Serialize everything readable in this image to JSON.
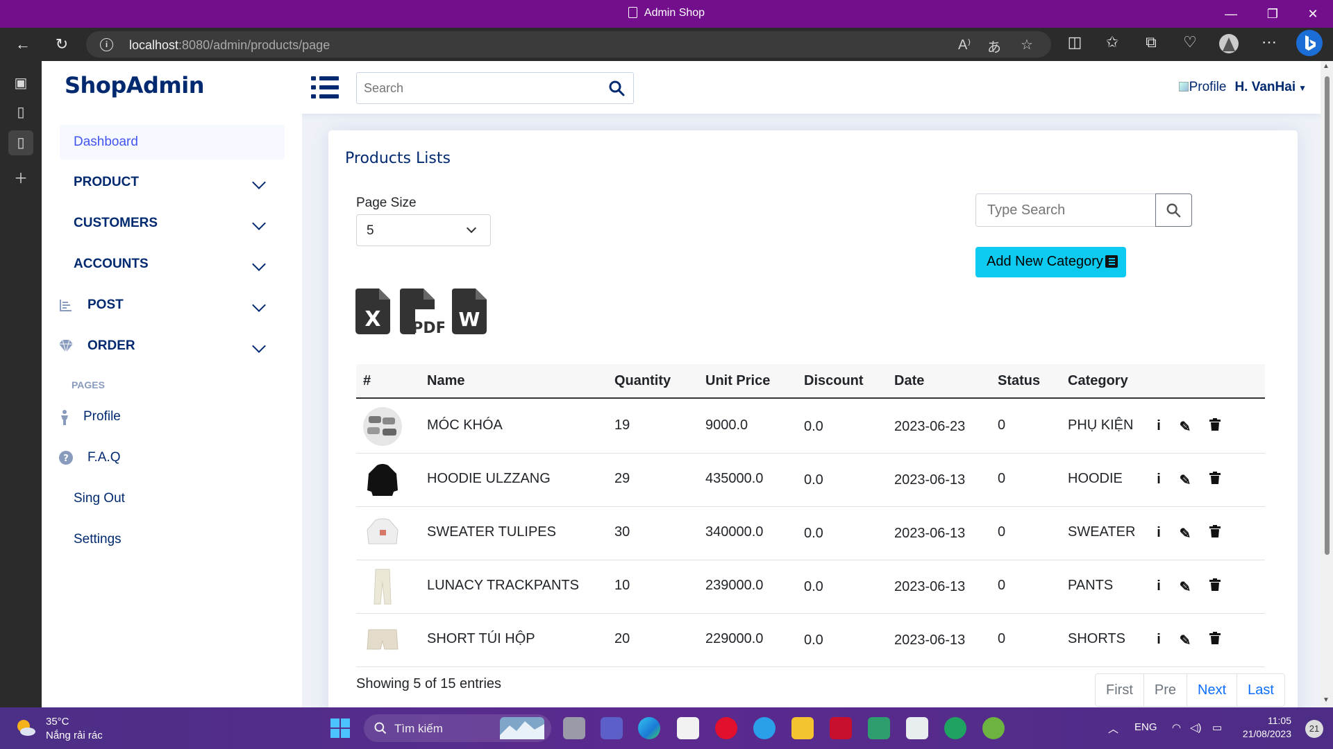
{
  "browser": {
    "window_title": "Admin Shop",
    "url_host": "localhost",
    "url_rest": ":8080/admin/products/page"
  },
  "header": {
    "logo": "ShopAdmin",
    "search_placeholder": "Search",
    "profile_img_alt": "Profile",
    "username": "H. VanHai"
  },
  "sidebar": {
    "items": [
      {
        "label": "Dashboard"
      },
      {
        "label": "PRODUCT"
      },
      {
        "label": "CUSTOMERS"
      },
      {
        "label": "ACCOUNTS"
      },
      {
        "label": "POST"
      },
      {
        "label": "ORDER"
      }
    ],
    "pages_heading": "PAGES",
    "pages": [
      {
        "label": "Profile"
      },
      {
        "label": "F.A.Q"
      },
      {
        "label": "Sing Out"
      },
      {
        "label": "Settings"
      }
    ]
  },
  "main": {
    "title": "Products Lists",
    "page_size_label": "Page Size",
    "page_size_value": "5",
    "search_placeholder": "Type Search",
    "add_button": "Add New Category",
    "columns": [
      "#",
      "Name",
      "Quantity",
      "Unit Price",
      "Discount",
      "Date",
      "Status",
      "Category"
    ],
    "rows": [
      {
        "name": "MÓC KHÓA",
        "quantity": "19",
        "unit_price": "9000.0",
        "discount": "0.0",
        "date": "2023-06-23",
        "status": "0",
        "category": "PHỤ KIỆN"
      },
      {
        "name": "HOODIE ULZZANG",
        "quantity": "29",
        "unit_price": "435000.0",
        "discount": "0.0",
        "date": "2023-06-13",
        "status": "0",
        "category": "HOODIE"
      },
      {
        "name": "SWEATER TULIPES",
        "quantity": "30",
        "unit_price": "340000.0",
        "discount": "0.0",
        "date": "2023-06-13",
        "status": "0",
        "category": "SWEATER"
      },
      {
        "name": "LUNACY TRACKPANTS",
        "quantity": "10",
        "unit_price": "239000.0",
        "discount": "0.0",
        "date": "2023-06-13",
        "status": "0",
        "category": "PANTS"
      },
      {
        "name": "SHORT TÚI HỘP",
        "quantity": "20",
        "unit_price": "229000.0",
        "discount": "0.0",
        "date": "2023-06-13",
        "status": "0",
        "category": "SHORTS"
      }
    ],
    "showing_text": "Showing 5 of 15 entries",
    "pagination": [
      "First",
      "Pre",
      "Next",
      "Last"
    ]
  },
  "taskbar": {
    "weather_temp": "35°C",
    "weather_desc": "Nắng rải rác",
    "search_label": "Tìm kiếm",
    "lang": "ENG",
    "time": "11:05",
    "date": "21/08/2023",
    "notifications": "21"
  }
}
